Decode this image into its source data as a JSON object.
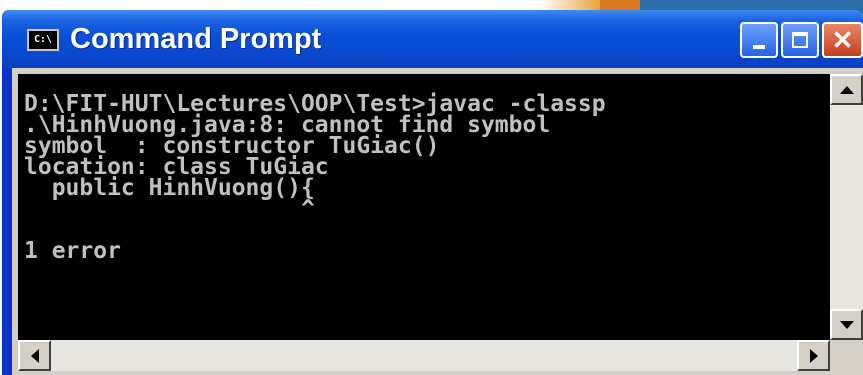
{
  "window": {
    "title": "Command Prompt",
    "icon_label": "C:\\",
    "controls": {
      "minimize_icon": "minimize-icon",
      "maximize_icon": "maximize-icon",
      "close_glyph": "✕"
    }
  },
  "console": {
    "lines": [
      "D:\\FIT-HUT\\Lectures\\OOP\\Test>javac -classp",
      ".\\HinhVuong.java:8: cannot find symbol",
      "symbol  : constructor TuGiac()",
      "location: class TuGiac",
      "  public HinhVuong(){",
      "                    ^",
      "",
      "1 error"
    ]
  },
  "colors": {
    "titlebar": "#0a50d8",
    "console_bg": "#000000",
    "console_text": "#c0c0c0",
    "close_button": "#c63f1e"
  }
}
